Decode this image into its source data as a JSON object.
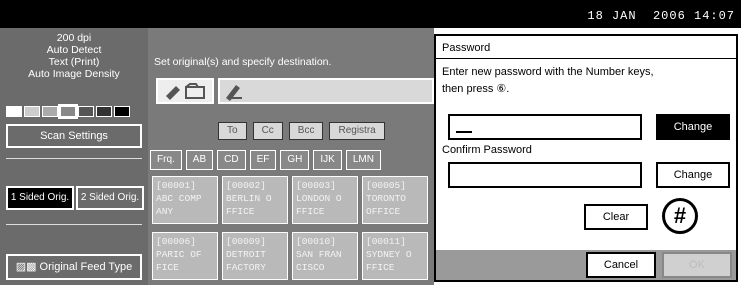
{
  "header": {
    "datetime": "18 JAN  2006 14:07"
  },
  "left": {
    "settings_lines": [
      "200 dpi",
      "Auto Detect",
      "Text (Print)",
      "Auto Image Density"
    ],
    "scan_settings_label": "Scan Settings",
    "sided_1_label": "1 Sided Orig.",
    "sided_2_label": "2 Sided Orig.",
    "feed_type_label": "Original Feed Type",
    "feed_icon_text": "▨▩"
  },
  "main": {
    "instruction": "Set original(s) and specify destination.",
    "tabs": [
      "To",
      "Cc",
      "Bcc",
      "Registra"
    ],
    "categories": [
      "Frq.",
      "AB",
      "CD",
      "EF",
      "GH",
      "IJK",
      "LMN"
    ],
    "destinations": [
      {
        "code": "[00001]",
        "line1": "ABC COMP",
        "line2": "ANY"
      },
      {
        "code": "[00002]",
        "line1": "BERLIN O",
        "line2": "FFICE"
      },
      {
        "code": "[00003]",
        "line1": "LONDON O",
        "line2": "FFICE"
      },
      {
        "code": "[00005]",
        "line1": "TORONTO",
        "line2": "OFFICE"
      },
      {
        "code": "[00006]",
        "line1": "PARIC OF",
        "line2": "FICE"
      },
      {
        "code": "[00009]",
        "line1": "DETROIT",
        "line2": "FACTORY"
      },
      {
        "code": "[00010]",
        "line1": "SAN FRAN",
        "line2": "CISCO"
      },
      {
        "code": "[00011]",
        "line1": "SYDNEY O",
        "line2": "FFICE"
      }
    ]
  },
  "dialog": {
    "title": "Password",
    "message": "Enter new password with the Number keys,\nthen press ⑥.",
    "change_label_1": "Change",
    "confirm_label": "Confirm Password",
    "change_label_2": "Change",
    "clear_label": "Clear",
    "hash_symbol": "#",
    "cancel_label": "Cancel",
    "ok_label": "OK"
  }
}
